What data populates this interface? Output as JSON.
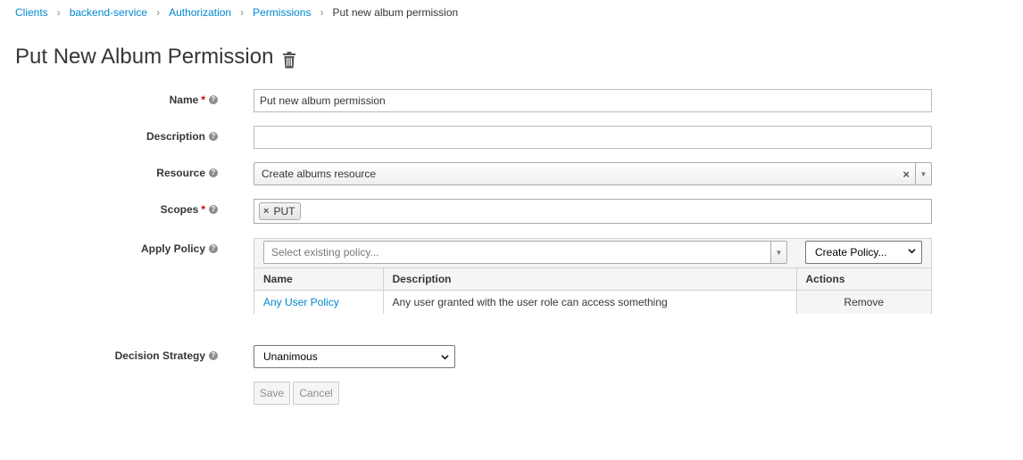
{
  "breadcrumb": {
    "items": [
      "Clients",
      "backend-service",
      "Authorization",
      "Permissions"
    ],
    "separator": "›",
    "current": "Put new album permission"
  },
  "page": {
    "title": "Put New Album Permission",
    "delete_icon": "trash-icon"
  },
  "form": {
    "name": {
      "label": "Name",
      "required": "*",
      "value": "Put new album permission"
    },
    "description": {
      "label": "Description",
      "value": ""
    },
    "resource": {
      "label": "Resource",
      "value": "Create albums resource",
      "clear": "×"
    },
    "scopes": {
      "label": "Scopes",
      "required": "*",
      "tags": [
        "PUT"
      ],
      "remove": "×"
    },
    "apply_policy": {
      "label": "Apply Policy",
      "placeholder": "Select existing policy...",
      "create_label": "Create Policy...",
      "columns": [
        "Name",
        "Description",
        "Actions"
      ],
      "rows": [
        {
          "name": "Any User Policy",
          "description": "Any user granted with the user role can access something",
          "action": "Remove"
        }
      ]
    },
    "decision_strategy": {
      "label": "Decision Strategy",
      "value": "Unanimous"
    }
  },
  "help_glyph": "?",
  "buttons": {
    "save": "Save",
    "cancel": "Cancel"
  },
  "colors": {
    "link": "#0088ce",
    "required": "#cc0000",
    "text": "#363636"
  }
}
